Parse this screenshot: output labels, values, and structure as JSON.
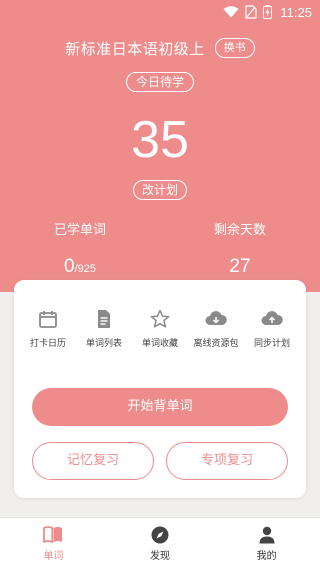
{
  "status": {
    "time": "11:25"
  },
  "header": {
    "book_title": "新标准日本语初级上",
    "change_book": "换书",
    "today_badge": "今日待学",
    "today_count": "35",
    "change_plan": "改计划"
  },
  "stats": {
    "learned_label": "已学单词",
    "learned_value": "0",
    "learned_total": "/925",
    "remaining_label": "剩余天数",
    "remaining_value": "27"
  },
  "tools": [
    {
      "label": "打卡日历",
      "icon": "calendar-icon"
    },
    {
      "label": "单词列表",
      "icon": "document-icon"
    },
    {
      "label": "单词收藏",
      "icon": "star-icon"
    },
    {
      "label": "离线资源包",
      "icon": "cloud-download-icon"
    },
    {
      "label": "同步计划",
      "icon": "cloud-upload-icon"
    }
  ],
  "actions": {
    "start": "开始背单词",
    "memory_review": "记忆复习",
    "special_review": "专项复习"
  },
  "tabbar": [
    {
      "label": "单词",
      "icon": "book-icon",
      "active": true
    },
    {
      "label": "发现",
      "icon": "compass-icon",
      "active": false
    },
    {
      "label": "我的",
      "icon": "user-icon",
      "active": false
    }
  ],
  "colors": {
    "accent": "#ee8c8c",
    "background": "#f0efed",
    "icon_gray": "#8a8a8a"
  }
}
